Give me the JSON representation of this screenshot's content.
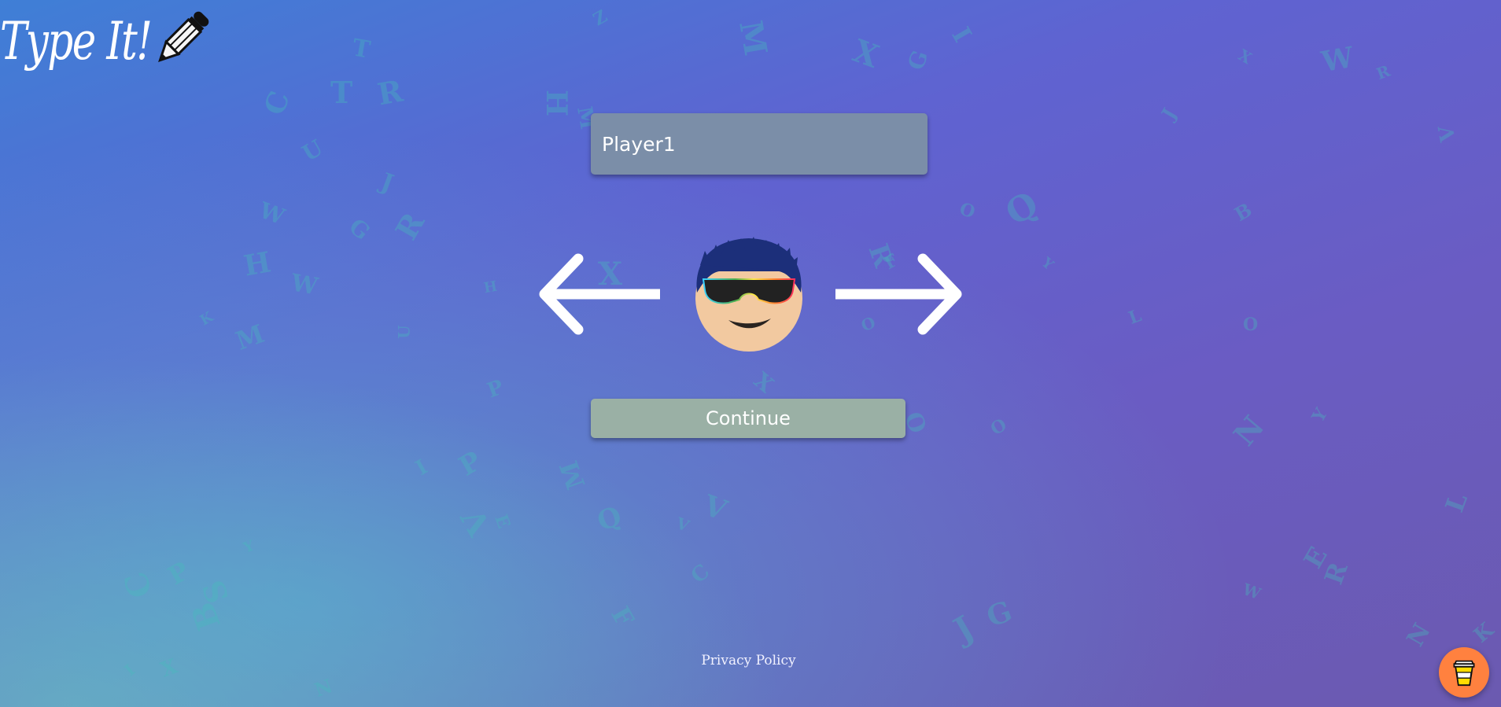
{
  "app": {
    "logo_text": "Type It!",
    "icons": {
      "logo": "pencil-icon",
      "prev": "arrow-left-icon",
      "next": "arrow-right-icon",
      "support": "coffee-cup-icon"
    }
  },
  "player": {
    "name_value": "Player1",
    "avatar": "avatar-sunglasses"
  },
  "actions": {
    "continue_label": "Continue"
  },
  "footer": {
    "privacy_label": "Privacy Policy"
  },
  "background_letters": [
    "Z",
    "M",
    "X",
    "G",
    "I",
    "W",
    "X",
    "R",
    "V",
    "J",
    "Q",
    "O",
    "C",
    "T",
    "T",
    "R",
    "H",
    "M",
    "U",
    "J",
    "R",
    "G",
    "W",
    "H",
    "W",
    "H",
    "K",
    "M",
    "U",
    "X",
    "X",
    "R",
    "F",
    "Y",
    "O",
    "L",
    "O",
    "B",
    "V",
    "I",
    "P",
    "P",
    "V",
    "E",
    "M",
    "Q",
    "V",
    "C",
    "F",
    "J",
    "G",
    "O",
    "N",
    "Y",
    "R",
    "E",
    "L",
    "K",
    "N",
    "W",
    "O",
    "C",
    "B",
    "S",
    "P",
    "Y",
    "X",
    "I",
    "N"
  ],
  "colors": {
    "input_bg": "#7b8ea8",
    "continue_bg": "#9ab0a5",
    "support_bg": "#ff813f",
    "hair": "#1c2f7a",
    "skin": "#f2c9a0"
  }
}
